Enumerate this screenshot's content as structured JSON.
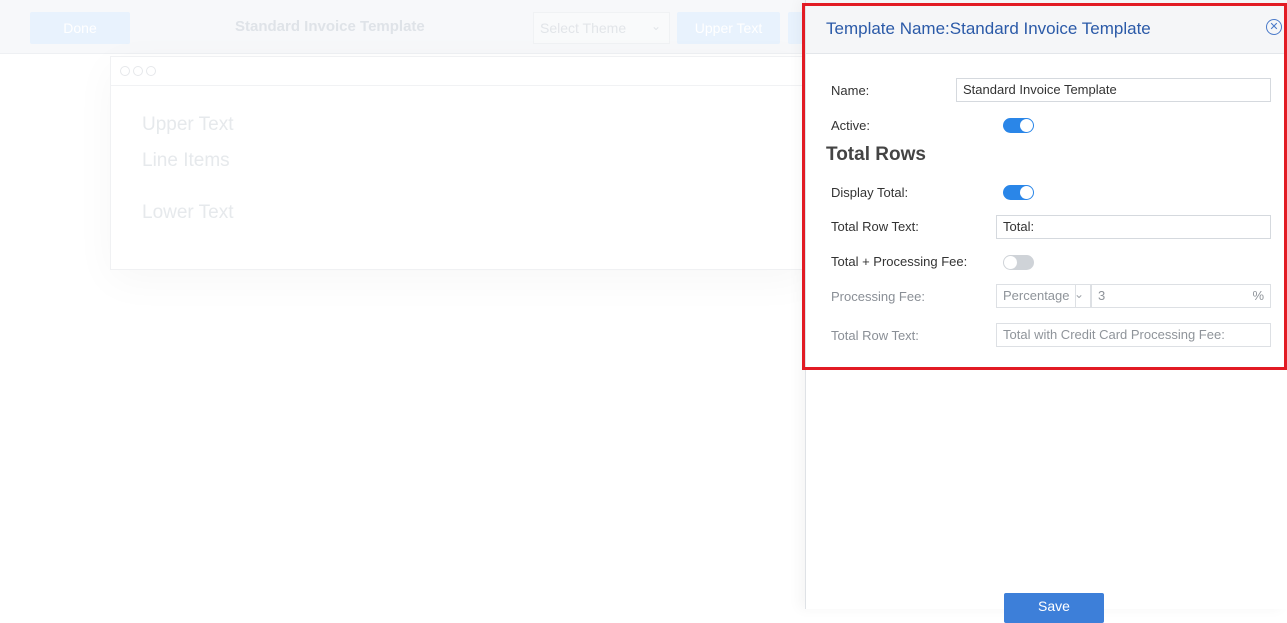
{
  "editor": {
    "done_label": "Done",
    "title": "Standard Invoice Template",
    "theme_placeholder": "Select Theme",
    "upper_text_button": "Upper Text",
    "canvas": {
      "upper_text": "Upper Text",
      "line_items": "Line Items",
      "lower_text": "Lower Text"
    }
  },
  "panel": {
    "title": "Template Name:Standard Invoice Template",
    "fields": {
      "name_label": "Name:",
      "name_value": "Standard Invoice Template",
      "active_label": "Active:",
      "active": true
    },
    "total_rows": {
      "section_title": "Total Rows",
      "display_total_label": "Display Total:",
      "display_total": true,
      "total_row_text_label": "Total Row Text:",
      "total_row_text_value": "Total:",
      "processing_fee_toggle_label": "Total + Processing Fee:",
      "processing_fee_enabled": false,
      "processing_fee_label": "Processing Fee:",
      "processing_fee_type": "Percentage",
      "processing_fee_value": "3",
      "processing_fee_unit": "%",
      "fee_row_text_label": "Total Row Text:",
      "fee_row_text_value": "Total with Credit Card Processing Fee:"
    },
    "save_label": "Save"
  },
  "colors": {
    "accent": "#2a86e8",
    "title_blue": "#2b5aa8",
    "highlight_red": "#e21b24"
  }
}
